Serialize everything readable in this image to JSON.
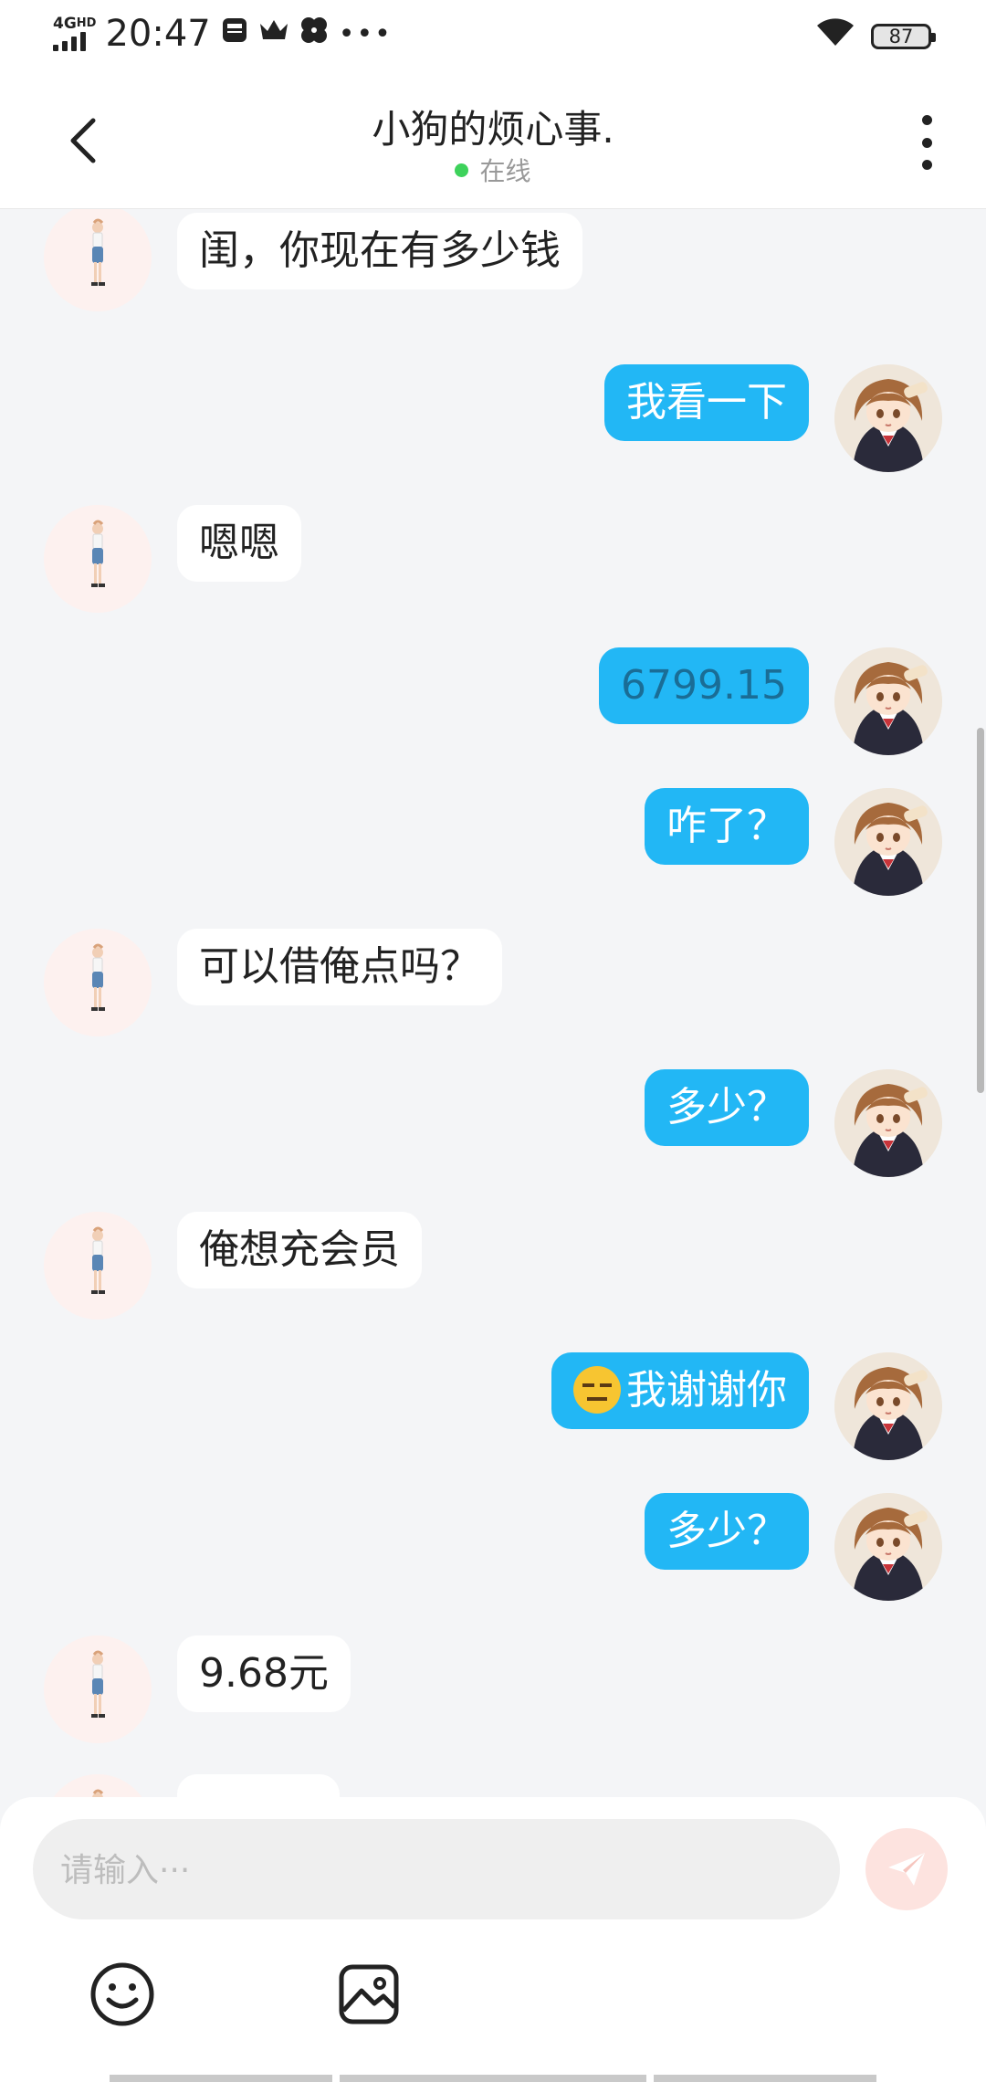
{
  "statusbar": {
    "network": "4G",
    "network_sup": "HD",
    "time": "20:47",
    "battery": "87"
  },
  "header": {
    "title": "小狗的烦心事.",
    "status": "在线"
  },
  "messages": [
    {
      "side": "left",
      "text": "闺，你现在有多少钱"
    },
    {
      "side": "right",
      "text": "我看一下"
    },
    {
      "side": "left",
      "text": "嗯嗯"
    },
    {
      "side": "right",
      "text": "6799.15"
    },
    {
      "side": "right",
      "text": "咋了？"
    },
    {
      "side": "left",
      "text": "可以借俺点吗？"
    },
    {
      "side": "right",
      "text": "多少？"
    },
    {
      "side": "left",
      "text": "俺想充会员"
    },
    {
      "side": "right",
      "text": "我谢谢你",
      "emoji": "expressionless-face-emoji"
    },
    {
      "side": "right",
      "text": "多少？"
    },
    {
      "side": "left",
      "text": "9.68元"
    }
  ],
  "input": {
    "placeholder": "请输入···",
    "value": ""
  },
  "toolbar": {
    "icons": [
      "smiley-icon",
      "image-icon"
    ],
    "send_icon": "paper-plane-icon"
  },
  "colors": {
    "bubble_sent": "#22b7f5",
    "bubble_received": "#ffffff",
    "online": "#3dd25b",
    "send_button": "#fde3df"
  }
}
